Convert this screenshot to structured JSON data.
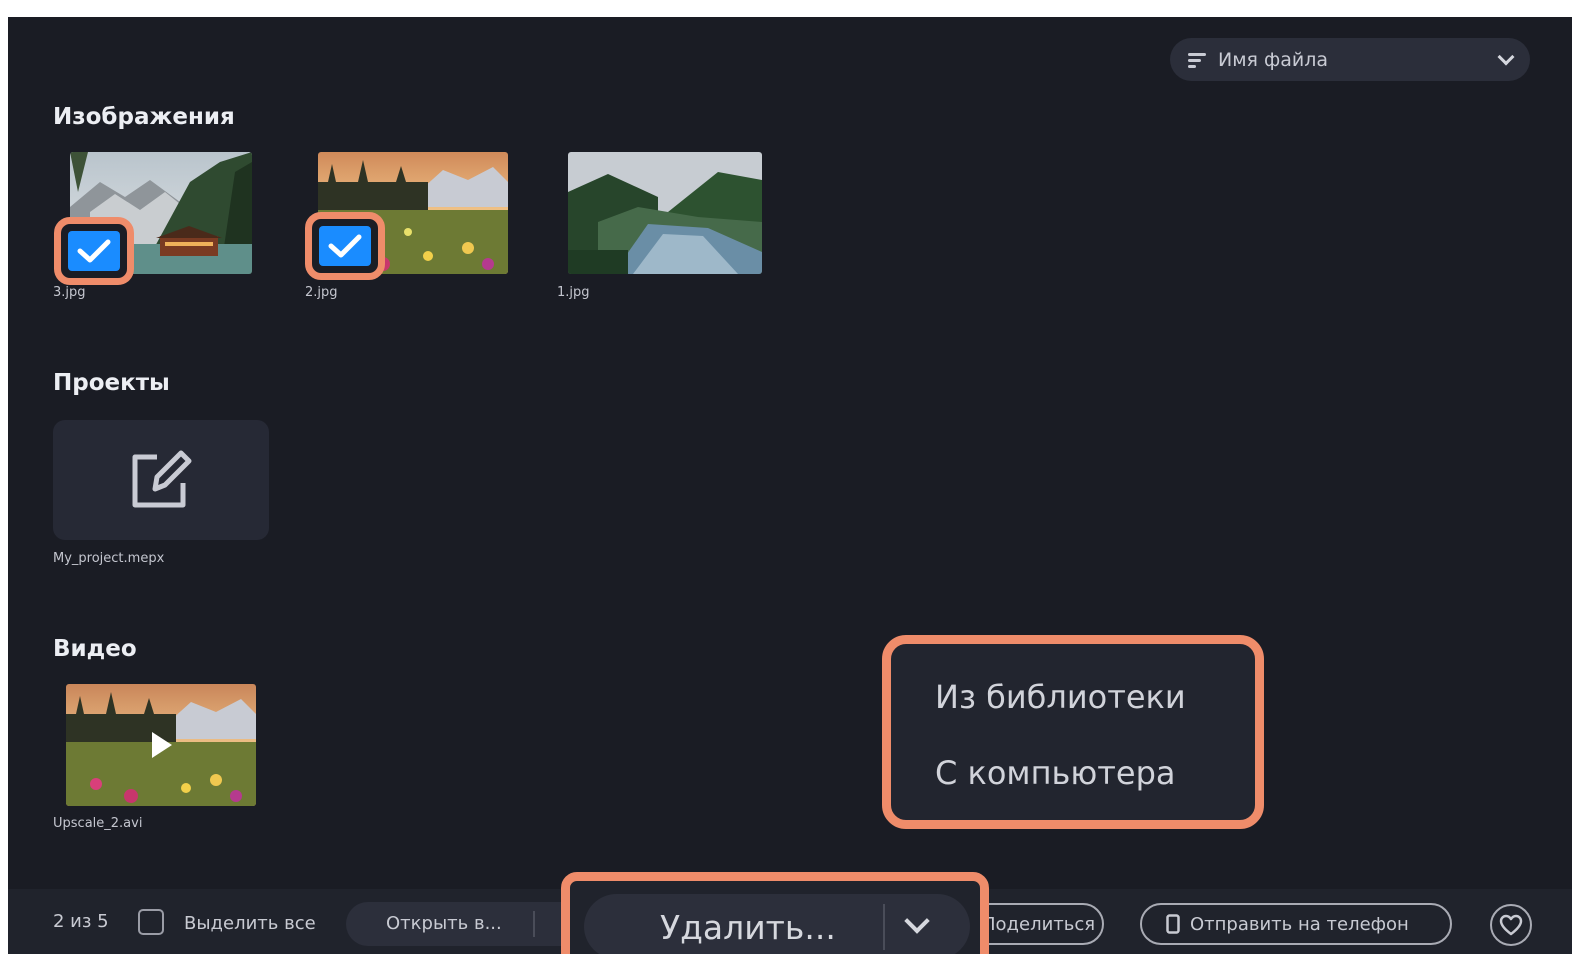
{
  "sort": {
    "label": "Имя файла",
    "icon": "sort-icon"
  },
  "sections": {
    "images": {
      "title": "Изображения",
      "items": [
        {
          "file": "3.jpg",
          "checked": true
        },
        {
          "file": "2.jpg",
          "checked": true
        },
        {
          "file": "1.jpg",
          "checked": false
        }
      ]
    },
    "projects": {
      "title": "Проекты",
      "items": [
        {
          "file": "My_project.mepx",
          "icon": "edit-icon"
        }
      ]
    },
    "video": {
      "title": "Видео",
      "items": [
        {
          "file": "Upscale_2.avi",
          "icon": "play-icon"
        }
      ]
    }
  },
  "delete_menu": {
    "items": [
      "Из библиотеки",
      "С компьютера"
    ]
  },
  "bottombar": {
    "count": "2 из 5",
    "select_all": "Выделить все",
    "open": "Открыть в...",
    "delete": "Удалить...",
    "share": "Поделиться",
    "send_phone": "Отправить на телефон",
    "favorite_icon": "heart-icon"
  },
  "colors": {
    "background": "#1a1c24",
    "accent_highlight": "#ef8c6a",
    "checkbox": "#1a8cff"
  }
}
